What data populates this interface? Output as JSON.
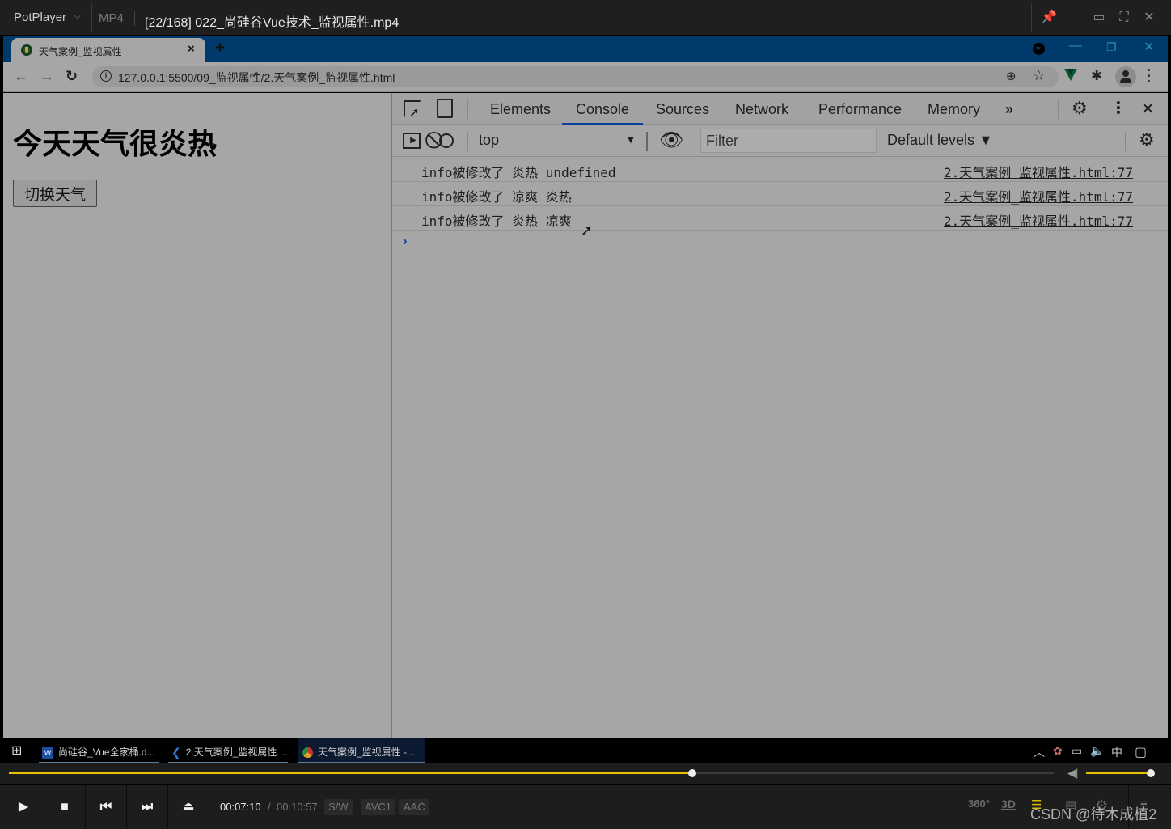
{
  "player": {
    "brand": "PotPlayer",
    "format": "MP4",
    "file_title": "[22/168] 022_尚硅谷Vue技术_监视属性.mp4",
    "current_time": "00:07:10",
    "time_sep": "/",
    "total_time": "00:10:57",
    "badges": [
      "S/W",
      "AVC1",
      "AAC"
    ],
    "progress_fraction": 0.654,
    "volume_fraction": 1.0,
    "right_icons": [
      "360°",
      "3D",
      "playlist",
      "chapter",
      "settings",
      "menu"
    ],
    "watermark": "CSDN @待木成植2"
  },
  "browser": {
    "tab_title": "天气案例_监视属性",
    "tab_close": "×",
    "new_tab": "+",
    "url": "127.0.0.1:5500/09_监视属性/2.天气案例_监视属性.html"
  },
  "page": {
    "heading": "今天天气很炎热",
    "button_label": "切换天气"
  },
  "devtools": {
    "tabs": [
      "Elements",
      "Console",
      "Sources",
      "Network",
      "Performance",
      "Memory"
    ],
    "active_tab": "Console",
    "more_tabs": "»",
    "context": "top",
    "filter_placeholder": "Filter",
    "levels": "Default levels ▼",
    "logs": [
      {
        "message": "info被修改了 炎热 undefined",
        "source": "2.天气案例_监视属性.html:77"
      },
      {
        "message": "info被修改了 凉爽 炎热",
        "source": "2.天气案例_监视属性.html:77"
      },
      {
        "message": "info被修改了 炎热 凉爽",
        "source": "2.天气案例_监视属性.html:77"
      }
    ],
    "prompt": "›"
  },
  "taskbar": {
    "items": [
      {
        "label": "尚硅谷_Vue全家桶.d...",
        "app": "word"
      },
      {
        "label": "2.天气案例_监视属性....",
        "app": "vscode"
      },
      {
        "label": "天气案例_监视属性 - ...",
        "app": "chrome"
      }
    ],
    "ime": "中"
  }
}
